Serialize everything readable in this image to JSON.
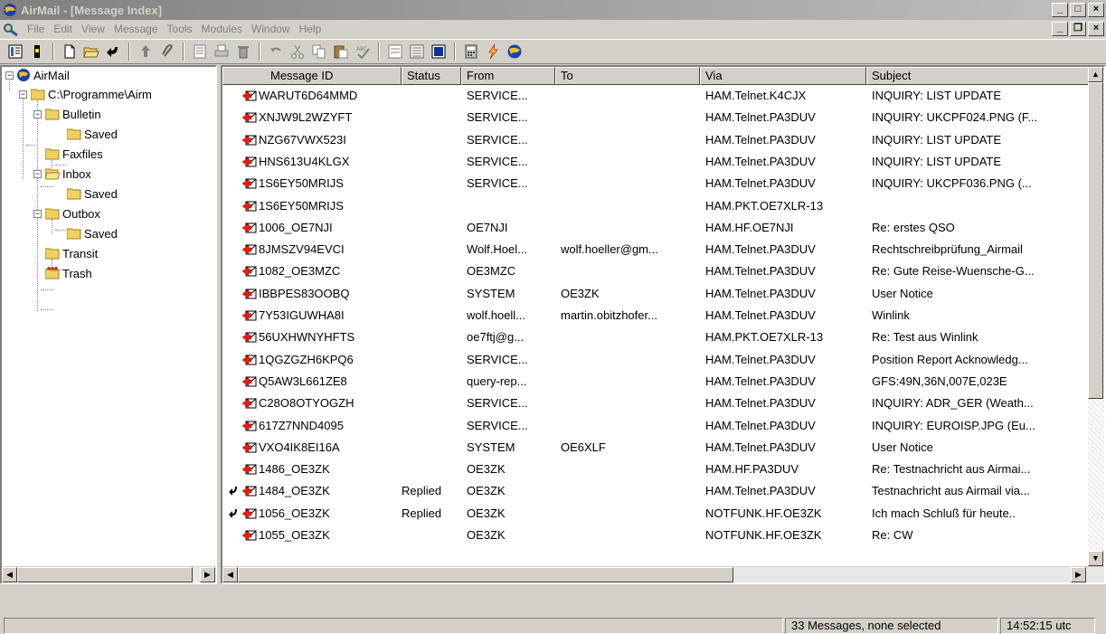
{
  "window": {
    "title": "AirMail - [Message Index]",
    "controls": [
      "_",
      "□",
      "×"
    ],
    "mdi_controls": [
      "_",
      "❐",
      "×"
    ]
  },
  "menu": [
    "File",
    "Edit",
    "View",
    "Message",
    "Tools",
    "Modules",
    "Window",
    "Help"
  ],
  "toolbar": {
    "icons": [
      "index-icon",
      "mailbox-icon",
      "new-message-icon",
      "open-folder-icon",
      "reply-icon",
      "attach-up-icon",
      "attach-icon",
      "print-preview-icon",
      "print-icon",
      "delete-icon",
      "undo-icon",
      "cut-icon",
      "copy-icon",
      "paste-icon",
      "spellcheck-icon",
      "view-list-icon",
      "view-details-icon",
      "view-preview-icon",
      "calculator-icon",
      "lightning-icon",
      "globe-icon"
    ]
  },
  "tree": {
    "root": "AirMail",
    "path": "C:\\Programme\\Airm",
    "folders": {
      "bulletin": "Bulletin",
      "bulletin_saved": "Saved",
      "faxfiles": "Faxfiles",
      "inbox": "Inbox",
      "inbox_saved": "Saved",
      "outbox": "Outbox",
      "outbox_saved": "Saved",
      "transit": "Transit",
      "trash": "Trash"
    }
  },
  "columns": [
    "Message ID",
    "Status",
    "From",
    "To",
    "Via",
    "Subject"
  ],
  "messages": [
    {
      "id": "WARUT6D64MMD",
      "status": "",
      "from": "SERVICE...",
      "to": "",
      "via": "HAM.Telnet.K4CJX",
      "subject": "INQUIRY: LIST UPDATE",
      "replied": false
    },
    {
      "id": "XNJW9L2WZYFT",
      "status": "",
      "from": "SERVICE...",
      "to": "",
      "via": "HAM.Telnet.PA3DUV",
      "subject": "INQUIRY: UKCPF024.PNG (F...",
      "replied": false
    },
    {
      "id": "NZG67VWX523I",
      "status": "",
      "from": "SERVICE...",
      "to": "",
      "via": "HAM.Telnet.PA3DUV",
      "subject": "INQUIRY: LIST UPDATE",
      "replied": false
    },
    {
      "id": "HNS613U4KLGX",
      "status": "",
      "from": "SERVICE...",
      "to": "",
      "via": "HAM.Telnet.PA3DUV",
      "subject": "INQUIRY: LIST UPDATE",
      "replied": false
    },
    {
      "id": "1S6EY50MRIJS",
      "status": "",
      "from": "SERVICE...",
      "to": "",
      "via": "HAM.Telnet.PA3DUV",
      "subject": "INQUIRY: UKCPF036.PNG (...",
      "replied": false
    },
    {
      "id": "1S6EY50MRIJS",
      "status": "",
      "from": "",
      "to": "",
      "via": "HAM.PKT.OE7XLR-13",
      "subject": "",
      "replied": false
    },
    {
      "id": "1006_OE7NJI",
      "status": "",
      "from": "OE7NJI",
      "to": "",
      "via": "HAM.HF.OE7NJI",
      "subject": "Re: erstes QSO",
      "replied": false
    },
    {
      "id": "8JMSZV94EVCI",
      "status": "",
      "from": "Wolf.Hoel...",
      "to": "wolf.hoeller@gm...",
      "via": "HAM.Telnet.PA3DUV",
      "subject": "Rechtschreibprüfung_Airmail",
      "replied": false
    },
    {
      "id": "1082_OE3MZC",
      "status": "",
      "from": "OE3MZC",
      "to": "",
      "via": "HAM.Telnet.PA3DUV",
      "subject": "Re: Gute Reise-Wuensche-G...",
      "replied": false
    },
    {
      "id": "IBBPES83OOBQ",
      "status": "",
      "from": "SYSTEM",
      "to": "OE3ZK",
      "via": "HAM.Telnet.PA3DUV",
      "subject": "User Notice",
      "replied": false
    },
    {
      "id": "7Y53IGUWHA8I",
      "status": "",
      "from": "wolf.hoell...",
      "to": "martin.obitzhofer...",
      "via": "HAM.Telnet.PA3DUV",
      "subject": "Winlink",
      "replied": false
    },
    {
      "id": "56UXHWNYHFTS",
      "status": "",
      "from": "oe7ftj@g...",
      "to": "",
      "via": "HAM.PKT.OE7XLR-13",
      "subject": "Re: Test aus Winlink",
      "replied": false
    },
    {
      "id": "1QGZGZH6KPQ6",
      "status": "",
      "from": "SERVICE...",
      "to": "",
      "via": "HAM.Telnet.PA3DUV",
      "subject": "Position Report Acknowledg...",
      "replied": false
    },
    {
      "id": "Q5AW3L661ZE8",
      "status": "",
      "from": "query-rep...",
      "to": "",
      "via": "HAM.Telnet.PA3DUV",
      "subject": "GFS:49N,36N,007E,023E",
      "replied": false
    },
    {
      "id": "C28O8OTYOGZH",
      "status": "",
      "from": "SERVICE...",
      "to": "",
      "via": "HAM.Telnet.PA3DUV",
      "subject": "INQUIRY: ADR_GER (Weath...",
      "replied": false
    },
    {
      "id": "617Z7NND4095",
      "status": "",
      "from": "SERVICE...",
      "to": "",
      "via": "HAM.Telnet.PA3DUV",
      "subject": "INQUIRY: EUROISP.JPG (Eu...",
      "replied": false
    },
    {
      "id": "VXO4IK8EI16A",
      "status": "",
      "from": "SYSTEM",
      "to": "OE6XLF",
      "via": "HAM.Telnet.PA3DUV",
      "subject": "User Notice",
      "replied": false
    },
    {
      "id": "1486_OE3ZK",
      "status": "",
      "from": "OE3ZK",
      "to": "",
      "via": "HAM.HF.PA3DUV",
      "subject": "Re: Testnachricht aus Airmai...",
      "replied": false
    },
    {
      "id": "1484_OE3ZK",
      "status": "Replied",
      "from": "OE3ZK",
      "to": "",
      "via": "HAM.Telnet.PA3DUV",
      "subject": "Testnachricht aus Airmail via...",
      "replied": true
    },
    {
      "id": "1056_OE3ZK",
      "status": "Replied",
      "from": "OE3ZK",
      "to": "",
      "via": "NOTFUNK.HF.OE3ZK",
      "subject": "Ich mach Schluß für heute..",
      "replied": true
    },
    {
      "id": "1055_OE3ZK",
      "status": "",
      "from": "OE3ZK",
      "to": "",
      "via": "NOTFUNK.HF.OE3ZK",
      "subject": "Re: CW",
      "replied": false
    }
  ],
  "status": {
    "count": "33 Messages, none selected",
    "time": "14:52:15 utc"
  }
}
